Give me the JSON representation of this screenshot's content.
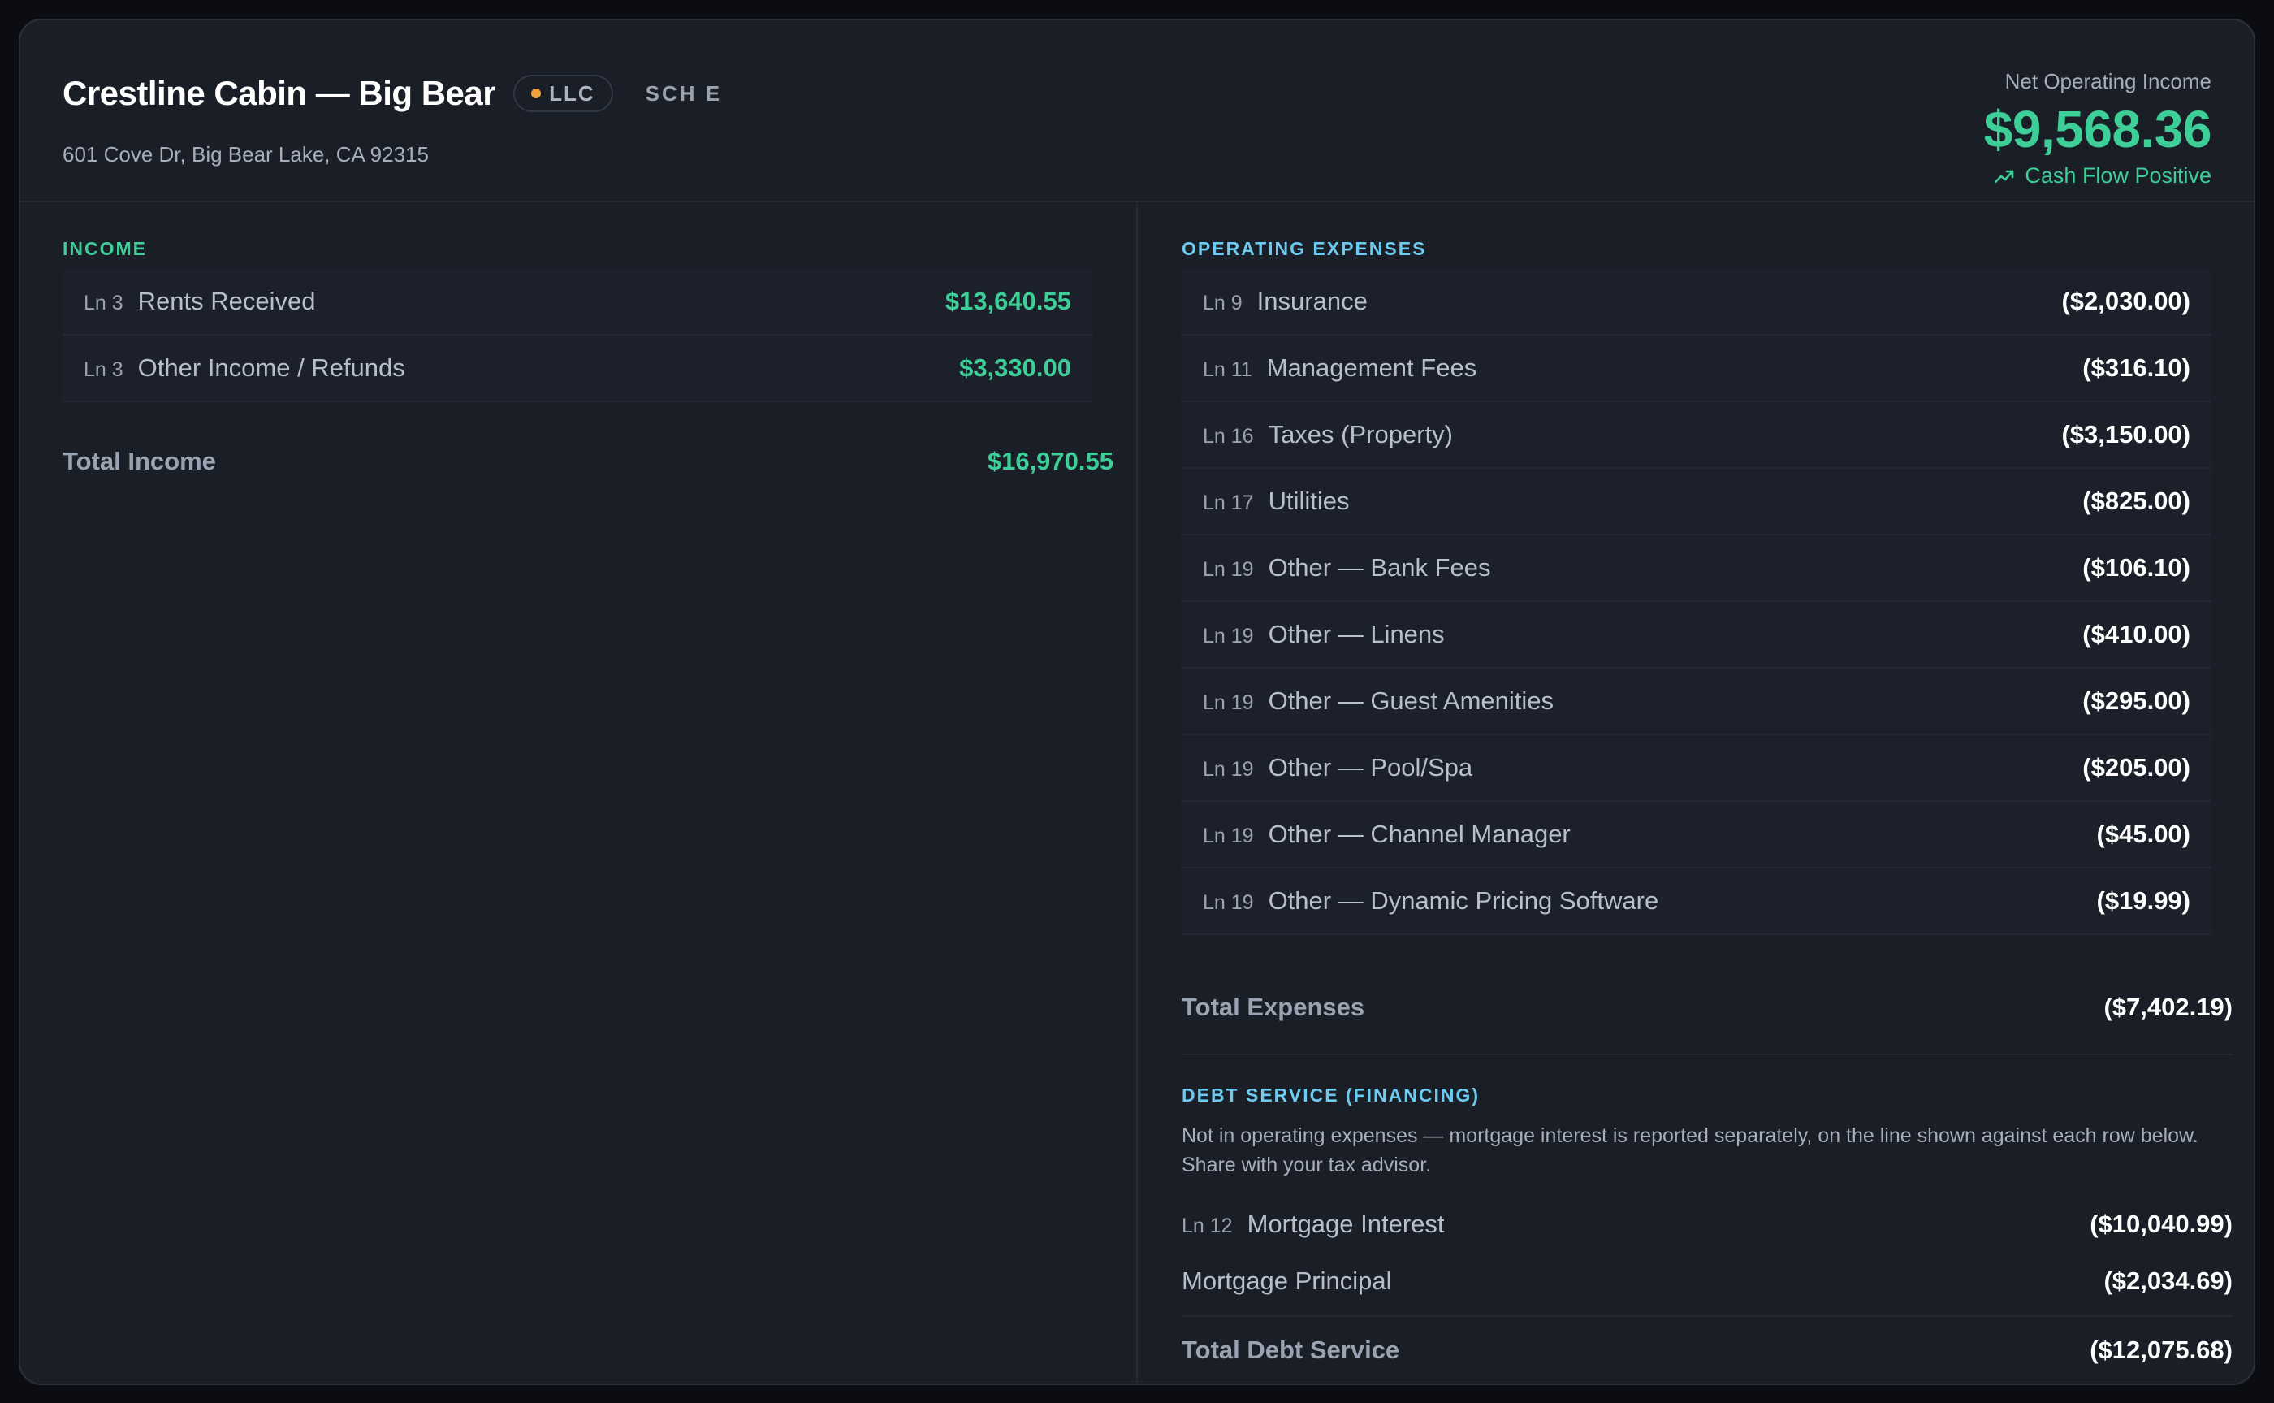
{
  "property": {
    "name": "Crestline Cabin — Big Bear",
    "entity_badge": "LLC",
    "entity_dot_color": "#f0a23a",
    "schedule": "SCH E",
    "address": "601 Cove Dr, Big Bear Lake, CA 92315"
  },
  "noi": {
    "label": "Net Operating Income",
    "value": "$9,568.36",
    "status": "Cash Flow Positive",
    "status_icon": "trending-up-icon",
    "color": "#3ecf98"
  },
  "income": {
    "title": "INCOME",
    "rows": [
      {
        "line": "Ln 3",
        "label": "Rents Received",
        "amount": "$13,640.55"
      },
      {
        "line": "Ln 3",
        "label": "Other Income / Refunds",
        "amount": "$3,330.00"
      }
    ],
    "total_label": "Total Income",
    "total_value": "$16,970.55"
  },
  "expenses": {
    "title": "OPERATING EXPENSES",
    "rows": [
      {
        "line": "Ln 9",
        "label": "Insurance",
        "amount": "($2,030.00)"
      },
      {
        "line": "Ln 11",
        "label": "Management Fees",
        "amount": "($316.10)"
      },
      {
        "line": "Ln 16",
        "label": "Taxes (Property)",
        "amount": "($3,150.00)"
      },
      {
        "line": "Ln 17",
        "label": "Utilities",
        "amount": "($825.00)"
      },
      {
        "line": "Ln 19",
        "label": "Other — Bank Fees",
        "amount": "($106.10)"
      },
      {
        "line": "Ln 19",
        "label": "Other — Linens",
        "amount": "($410.00)"
      },
      {
        "line": "Ln 19",
        "label": "Other — Guest Amenities",
        "amount": "($295.00)"
      },
      {
        "line": "Ln 19",
        "label": "Other — Pool/Spa",
        "amount": "($205.00)"
      },
      {
        "line": "Ln 19",
        "label": "Other — Channel Manager",
        "amount": "($45.00)"
      },
      {
        "line": "Ln 19",
        "label": "Other — Dynamic Pricing Software",
        "amount": "($19.99)"
      }
    ],
    "total_label": "Total Expenses",
    "total_value": "($7,402.19)"
  },
  "debt": {
    "title": "DEBT SERVICE (FINANCING)",
    "note": "Not in operating expenses — mortgage interest is reported separately, on the line shown against each row below. Share with your tax advisor.",
    "interest_line": "Ln 12",
    "interest_label": "Mortgage Interest",
    "interest_amount": "($10,040.99)",
    "principal_label": "Mortgage Principal",
    "principal_amount": "($2,034.69)",
    "total_label": "Total Debt Service",
    "total_value": "($12,075.68)"
  }
}
